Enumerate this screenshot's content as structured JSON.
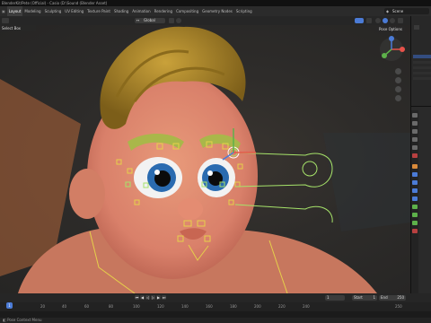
{
  "window": {
    "title": "BlenderKit/Pete (Official) - Casio (D:\\Sound (Blender Asset)"
  },
  "topbar": {
    "tabs": [
      "Layout",
      "Modeling",
      "Sculpting",
      "UV Editing",
      "Texture Paint",
      "Shading",
      "Animation",
      "Rendering",
      "Compositing",
      "Geometry Nodes",
      "Scripting"
    ],
    "active_tab": "Layout",
    "scene_label": "Scene"
  },
  "viewport_header": {
    "mode": "Global"
  },
  "viewport": {
    "select_box_label": "Select Box",
    "pose_options_label": "Pose Options"
  },
  "timeline": {
    "current_frame": "1",
    "start_label": "Start",
    "start_value": "1",
    "end_label": "End",
    "end_value": "250"
  },
  "ruler": {
    "ticks": [
      "0",
      "20",
      "40",
      "60",
      "80",
      "100",
      "120",
      "140",
      "160",
      "180",
      "200",
      "220",
      "240",
      "250"
    ],
    "playhead": "1"
  },
  "statusbar": {
    "text": "Pose Context Menu"
  },
  "colors": {
    "accent": "#4b7bd6",
    "bone_green": "#a6e36a",
    "bone_yellow": "#e6d04a",
    "skin": "#d9876a",
    "hair": "#b08a2a"
  }
}
